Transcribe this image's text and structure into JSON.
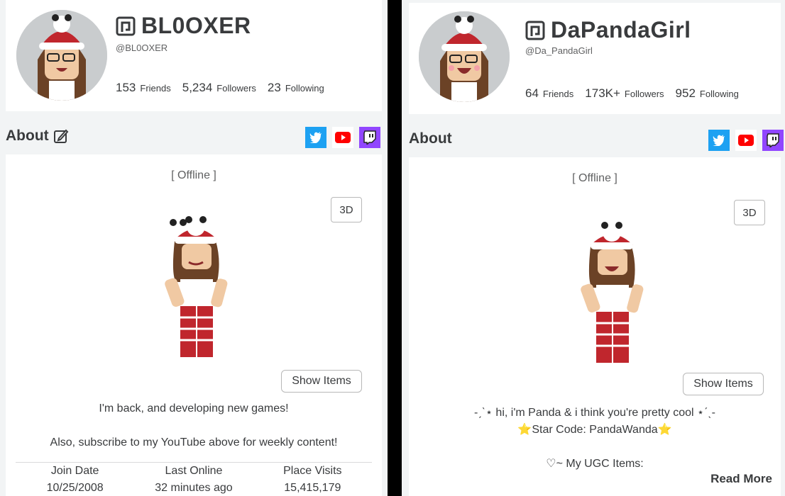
{
  "left": {
    "display_name": "BL0OXER",
    "handle": "@BL0OXER",
    "friends_count": "153",
    "friends_label": "Friends",
    "followers_count": "5,234",
    "followers_label": "Followers",
    "following_count": "23",
    "following_label": "Following",
    "about_title": "About",
    "status": "[ Offline ]",
    "btn_3d": "3D",
    "show_items": "Show Items",
    "description_line1": "I'm back, and developing new games!",
    "description_line2": "Also, subscribe to my YouTube above for weekly content!",
    "join_date_label": "Join Date",
    "join_date_value": "10/25/2008",
    "last_online_label": "Last Online",
    "last_online_value": "32 minutes ago",
    "place_visits_label": "Place Visits",
    "place_visits_value": "15,415,179"
  },
  "right": {
    "display_name": "DaPandaGirl",
    "handle": "@Da_PandaGirl",
    "friends_count": "64",
    "friends_label": "Friends",
    "followers_count": "173K+",
    "followers_label": "Followers",
    "following_count": "952",
    "following_label": "Following",
    "about_title": "About",
    "status": "[ Offline ]",
    "btn_3d": "3D",
    "show_items": "Show Items",
    "description_line1": "-ˏˋ⋆ hi, i'm Panda & i think you're pretty cool ⋆ˊˎ-",
    "description_line2": "⭐Star Code: PandaWanda⭐",
    "description_line3": "♡~ My UGC Items:",
    "read_more": "Read More"
  },
  "icons": {
    "twitter": "twitter-icon",
    "youtube": "youtube-icon",
    "twitch": "twitch-icon",
    "edit": "edit-icon",
    "roblox_premium": "premium-icon"
  },
  "colors": {
    "twitter": "#1da1f2",
    "youtube": "#ff0000",
    "twitch": "#9146ff",
    "text": "#393b3d",
    "background": "#f2f4f5"
  }
}
